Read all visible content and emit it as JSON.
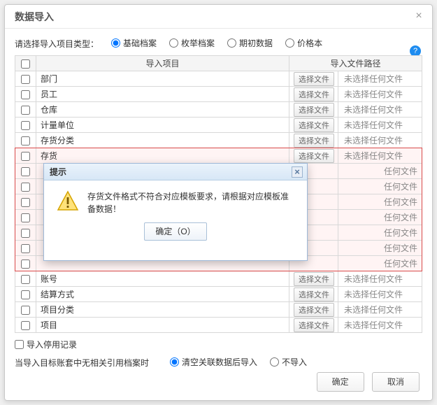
{
  "dialog": {
    "title": "数据导入",
    "type_label": "请选择导入项目类型：",
    "radios": [
      {
        "label": "基础档案",
        "checked": true
      },
      {
        "label": "枚举档案",
        "checked": false
      },
      {
        "label": "期初数据",
        "checked": false
      },
      {
        "label": "价格本",
        "checked": false
      }
    ],
    "columns": {
      "item": "导入项目",
      "path": "导入文件路径"
    },
    "file_btn": "选择文件",
    "file_none": "未选择任何文件",
    "file_none_short": "任何文件",
    "rows": [
      {
        "name": "部门",
        "short": false,
        "hl": false
      },
      {
        "name": "员工",
        "short": false,
        "hl": false
      },
      {
        "name": "仓库",
        "short": false,
        "hl": false
      },
      {
        "name": "计量单位",
        "short": false,
        "hl": false
      },
      {
        "name": "存货分类",
        "short": false,
        "hl": false
      },
      {
        "name": "存货",
        "short": false,
        "hl": true
      },
      {
        "name": "",
        "short": true,
        "hl": true
      },
      {
        "name": "",
        "short": true,
        "hl": true
      },
      {
        "name": "",
        "short": true,
        "hl": true
      },
      {
        "name": "",
        "short": true,
        "hl": true
      },
      {
        "name": "",
        "short": true,
        "hl": true
      },
      {
        "name": "",
        "short": true,
        "hl": true
      },
      {
        "name": "",
        "short": true,
        "hl": true
      },
      {
        "name": "账号",
        "short": false,
        "hl": false
      },
      {
        "name": "结算方式",
        "short": false,
        "hl": false
      },
      {
        "name": "项目分类",
        "short": false,
        "hl": false
      },
      {
        "name": "项目",
        "short": false,
        "hl": false
      }
    ],
    "import_disabled": "导入停用记录",
    "ref_label": "当导入目标账套中无相关引用档案时",
    "ref_radios": [
      {
        "label": "清空关联数据后导入",
        "checked": true
      },
      {
        "label": "不导入",
        "checked": false
      }
    ],
    "ok": "确定",
    "cancel": "取消"
  },
  "prompt": {
    "title": "提示",
    "message": "存货文件格式不符合对应模板要求，请根据对应模板准备数据！",
    "ok": "确定（O）"
  }
}
